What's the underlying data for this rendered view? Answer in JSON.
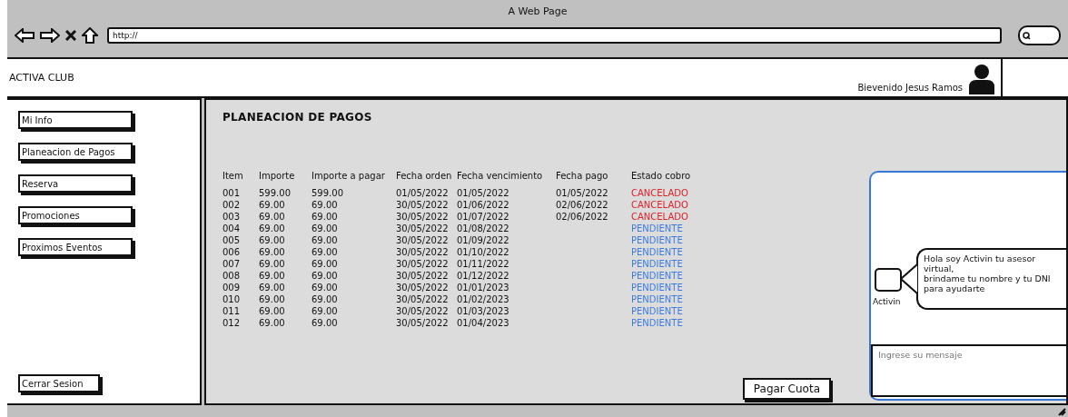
{
  "window": {
    "title": "A Web Page",
    "url": "http://"
  },
  "header": {
    "brand": "ACTIVA CLUB",
    "welcome": "Bievenido Jesus Ramos"
  },
  "sidebar": {
    "items": [
      "Mi Info",
      "Planeacion de Pagos",
      "Reserva",
      "Promociones",
      "Proximos Eventos"
    ],
    "logout": "Cerrar Sesion"
  },
  "page": {
    "title": "PLANEACION DE PAGOS"
  },
  "table": {
    "columns": [
      "Item",
      "Importe",
      "Importe a pagar",
      "Fecha orden",
      "Fecha vencimiento",
      "Fecha pago",
      "Estado cobro"
    ],
    "rows": [
      {
        "cells": [
          "001",
          "599.00",
          "599.00",
          "01/05/2022",
          "01/05/2022",
          "01/05/2022"
        ],
        "status": "CANCELADO",
        "color": "#e0202a"
      },
      {
        "cells": [
          "002",
          "69.00",
          "69.00",
          "30/05/2022",
          "01/06/2022",
          "02/06/2022"
        ],
        "status": "CANCELADO",
        "color": "#e0202a"
      },
      {
        "cells": [
          "003",
          "69.00",
          "69.00",
          "30/05/2022",
          "01/07/2022",
          "02/06/2022"
        ],
        "status": "CANCELADO",
        "color": "#e0202a"
      },
      {
        "cells": [
          "004",
          "69.00",
          "69.00",
          "30/05/2022",
          "01/08/2022",
          ""
        ],
        "status": "PENDIENTE",
        "color": "#3b7be0"
      },
      {
        "cells": [
          "005",
          "69.00",
          "69.00",
          "30/05/2022",
          "01/09/2022",
          ""
        ],
        "status": "PENDIENTE",
        "color": "#3b7be0"
      },
      {
        "cells": [
          "006",
          "69.00",
          "69.00",
          "30/05/2022",
          "01/10/2022",
          ""
        ],
        "status": "PENDIENTE",
        "color": "#3b7be0"
      },
      {
        "cells": [
          "007",
          "69.00",
          "69.00",
          "30/05/2022",
          "01/11/2022",
          ""
        ],
        "status": "PENDIENTE",
        "color": "#3b7be0"
      },
      {
        "cells": [
          "008",
          "69.00",
          "69.00",
          "30/05/2022",
          "01/12/2022",
          ""
        ],
        "status": "PENDIENTE",
        "color": "#3b7be0"
      },
      {
        "cells": [
          "009",
          "69.00",
          "69.00",
          "30/05/2022",
          "01/01/2023",
          ""
        ],
        "status": "PENDIENTE",
        "color": "#3b7be0"
      },
      {
        "cells": [
          "010",
          "69.00",
          "69.00",
          "30/05/2022",
          "01/02/2023",
          ""
        ],
        "status": "PENDIENTE",
        "color": "#3b7be0"
      },
      {
        "cells": [
          "011",
          "69.00",
          "69.00",
          "30/05/2022",
          "01/03/2023",
          ""
        ],
        "status": "PENDIENTE",
        "color": "#3b7be0"
      },
      {
        "cells": [
          "012",
          "69.00",
          "69.00",
          "30/05/2022",
          "01/04/2023",
          ""
        ],
        "status": "PENDIENTE",
        "color": "#3b7be0"
      }
    ]
  },
  "pay_button": "Pagar Cuota",
  "chat": {
    "bot_name": "Activin",
    "message": "Hola soy Activin tu asesor virtual,\nbrindame tu nombre y tu DNI para ayudarte",
    "placeholder": "Ingrese su mensaje"
  }
}
